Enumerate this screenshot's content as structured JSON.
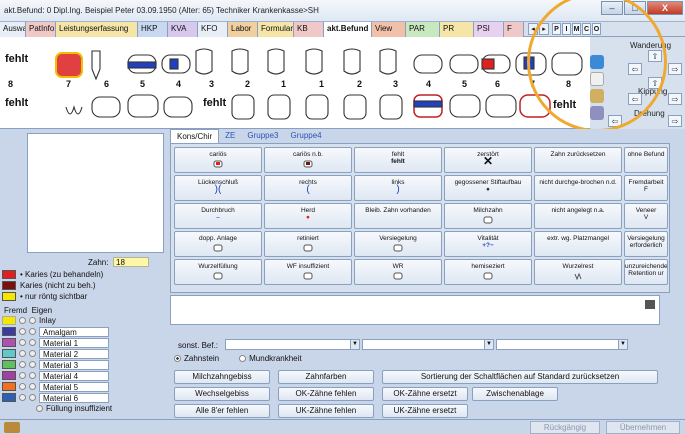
{
  "window": {
    "title": "akt.Befund: 0  Dipl.Ing. Beispiel Peter  03.09.1950 (Alter: 65)  Techniker Krankenkasse>SH",
    "minimize": "–",
    "maximize": "□",
    "close": "X"
  },
  "tabs": [
    {
      "label": "Auswahl",
      "color": "#e8eef6"
    },
    {
      "label": "PatInfo",
      "color": "#f0c8c8"
    },
    {
      "label": "Leistungserfassung",
      "color": "#f5e6a8"
    },
    {
      "label": "HKP",
      "color": "#c8d8f0"
    },
    {
      "label": "KVA",
      "color": "#d8c8ee"
    },
    {
      "label": "KFO",
      "color": "#e8eef6"
    },
    {
      "label": "Labor",
      "color": "#f0d0a0"
    },
    {
      "label": "Formular",
      "color": "#f5e6a8"
    },
    {
      "label": "KB",
      "color": "#f0c8c8"
    },
    {
      "label": "akt.Befund",
      "color": "#ffffff"
    },
    {
      "label": "View",
      "color": "#f0c0a8"
    },
    {
      "label": "PAR",
      "color": "#c8e8c0"
    },
    {
      "label": "PR",
      "color": "#f5e6a8"
    },
    {
      "label": "PSI",
      "color": "#e8d0f0"
    },
    {
      "label": "F",
      "color": "#f0c8c8"
    }
  ],
  "tab_nav": [
    "◂",
    "▸"
  ],
  "tab_letters": [
    "P",
    "I",
    "M",
    "C",
    "O"
  ],
  "chart": {
    "upper_numbers": [
      "8",
      "7",
      "6",
      "5",
      "4",
      "3",
      "2",
      "1",
      "1",
      "2",
      "3",
      "4",
      "5",
      "6",
      "7",
      "8"
    ],
    "fehlt": "fehlt"
  },
  "right_panel": {
    "wanderung": "Wanderung",
    "kippung": "Kippung",
    "drehung": "Drehung"
  },
  "zahn": {
    "label": "Zahn:",
    "value": "18"
  },
  "legend": [
    {
      "label": "Karies (zu behandeln)",
      "color": "#e02020",
      "bullet": true
    },
    {
      "label": "Karies (nicht zu beh.)",
      "color": "#7a1010",
      "bullet": false
    },
    {
      "label": "nur röntg sichtbar",
      "color": "#f5e800",
      "bullet": true
    }
  ],
  "fremd_eigen": {
    "fremd": "Fremd",
    "eigen": "Eigen",
    "inlay": "Inlay"
  },
  "materials": [
    {
      "label": "Amalgam",
      "color": "#3a3aa0"
    },
    {
      "label": "Material 1",
      "color": "#b050b0"
    },
    {
      "label": "Material 2",
      "color": "#60c8c8"
    },
    {
      "label": "Material 3",
      "color": "#60c060"
    },
    {
      "label": "Material 4",
      "color": "#a040a0"
    },
    {
      "label": "Material 5",
      "color": "#f07020"
    },
    {
      "label": "Material 6",
      "color": "#3060b0"
    }
  ],
  "fuellung_insuff": "Füllung insuffizient",
  "subtabs": [
    "Kons/Chir",
    "ZE",
    "Gruppe3",
    "Gruppe4"
  ],
  "grid_buttons": [
    [
      "cariös",
      "cariös n.b.",
      "fehlt",
      "zerstört",
      "Zahn zurücksetzen",
      "ohne Befund"
    ],
    [
      "Lückenschluß",
      "rechts",
      "links",
      "gegossener Stiftaufbau",
      "nicht durchge-brochen n.d.",
      "Fremdarbeit"
    ],
    [
      "Durchbruch",
      "Herd",
      "Bleib. Zahn vorhanden",
      "Milchzahn",
      "nicht angelegt n.a.",
      "Veneer"
    ],
    [
      "dopp. Anlage",
      "retiniert",
      "Versiegelung",
      "Vitalität",
      "extr. wg. Platzmangel",
      "Versiegelung erforderlich"
    ],
    [
      "Wurzelfüllung",
      "WF insuffizient",
      "WR",
      "hemiseziert",
      "Wurzelrest",
      "unzureichende Retention ur"
    ]
  ],
  "grid_subs": {
    "fehlt_bold": "fehlt",
    "fremd_f": "F",
    "veneer_v": "V"
  },
  "sonst_bef": "sonst. Bef.:",
  "radios": {
    "zahnstein": "Zahnstein",
    "mundkrankheit": "Mundkrankheit"
  },
  "actions": {
    "milchzahngebiss": "Milchzahngebiss",
    "zahnfarben": "Zahnfarben",
    "sortierung": "Sortierung der Schaltflächen auf Standard zurücksetzen",
    "wechselgebiss": "Wechselgebiss",
    "ok_fehlen": "OK-Zähne fehlen",
    "ok_ersetzt": "OK-Zähne ersetzt",
    "zwischenablage": "Zwischenablage",
    "alle8": "Alle 8'er fehlen",
    "uk_fehlen": "UK-Zähne fehlen",
    "uk_ersetzt": "UK-Zähne ersetzt"
  },
  "status": {
    "rueckgaengig": "Rückgängig",
    "uebernehmen": "Übernehmen"
  }
}
